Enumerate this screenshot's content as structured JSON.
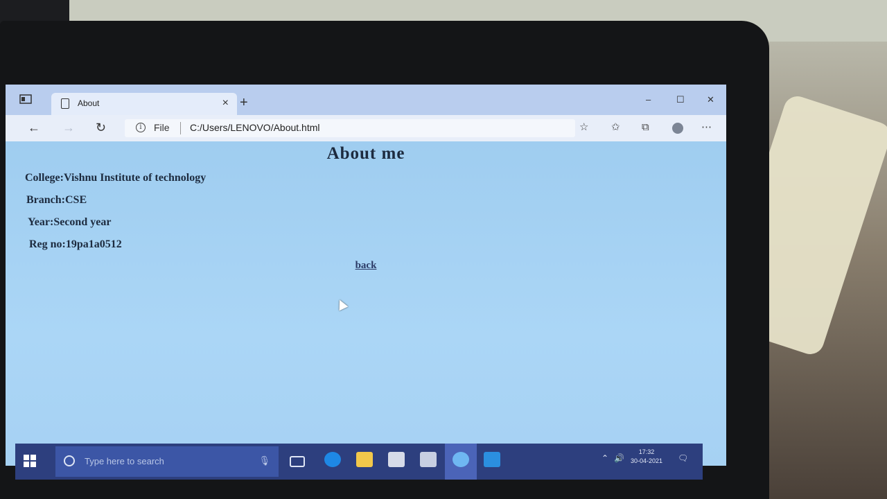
{
  "browser": {
    "tab_title": "About",
    "tab_close": "×",
    "new_tab": "+",
    "window_controls": {
      "minimize": "–",
      "maximize": "☐",
      "close": "✕"
    },
    "nav": {
      "back": "←",
      "forward": "→",
      "refresh": "↻"
    },
    "address": {
      "scheme_label": "File",
      "url": "C:/Users/LENOVO/About.html"
    },
    "toolbar_icons": [
      "add-favorite-icon",
      "favorites-icon",
      "collections-icon",
      "profile-icon",
      "more-icon"
    ]
  },
  "page": {
    "heading": "About me",
    "fields": {
      "college": "College:Vishnu Institute of technology",
      "branch": "Branch:CSE",
      "year": "Year:Second year",
      "reg": "Reg no:19pa1a0512"
    },
    "back_link": "back"
  },
  "taskbar": {
    "search_placeholder": "Type here to search",
    "clock_time": "17:32",
    "clock_date": "30-04-2021",
    "colors": {
      "taskbar": "#2d3f7e",
      "edge": "#1e88e5",
      "vscode": "#2b8fe0"
    }
  }
}
